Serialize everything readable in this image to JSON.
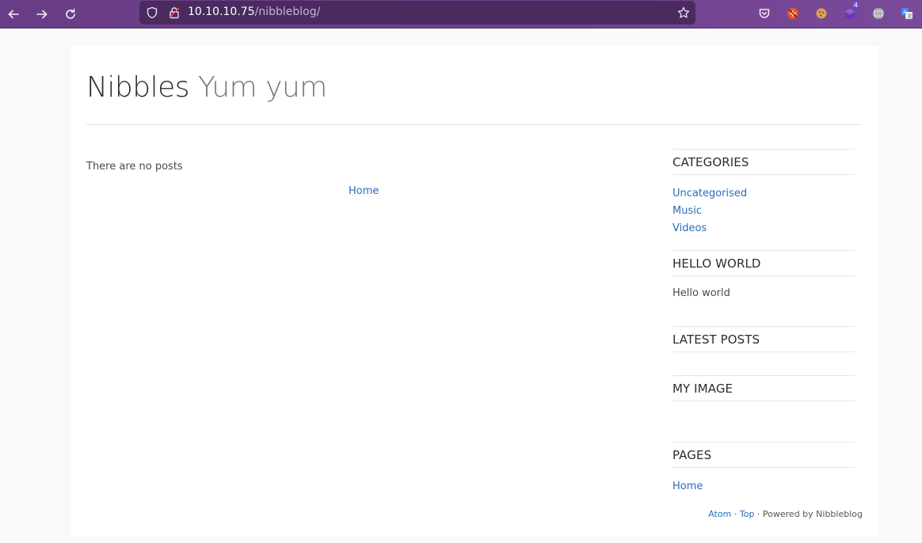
{
  "browser": {
    "url_host": "10.10.10.75",
    "url_path": "/nibbleblog/",
    "extension_badge": "4",
    "icons": [
      "back-arrow-icon",
      "forward-arrow-icon",
      "reload-icon",
      "shield-icon",
      "lock-icon",
      "bookmark-star-icon",
      "pocket-icon",
      "ublock-icon",
      "cookie-icon",
      "stack-icon",
      "globe-icon",
      "translate-icon"
    ]
  },
  "site": {
    "name": "Nibbles",
    "slogan": "Yum yum"
  },
  "main": {
    "no_posts": "There are no posts",
    "home_link": "Home"
  },
  "sidebar": {
    "categories": {
      "title": "CATEGORIES",
      "items": [
        "Uncategorised",
        "Music",
        "Videos"
      ]
    },
    "hello": {
      "title": "HELLO WORLD",
      "text": "Hello world"
    },
    "latest": {
      "title": "LATEST POSTS"
    },
    "image": {
      "title": "MY IMAGE"
    },
    "pages": {
      "title": "PAGES",
      "items": [
        "Home"
      ]
    }
  },
  "footer": {
    "atom": "Atom",
    "sep1": " · ",
    "top": "Top",
    "powered": " · Powered by Nibbleblog"
  }
}
